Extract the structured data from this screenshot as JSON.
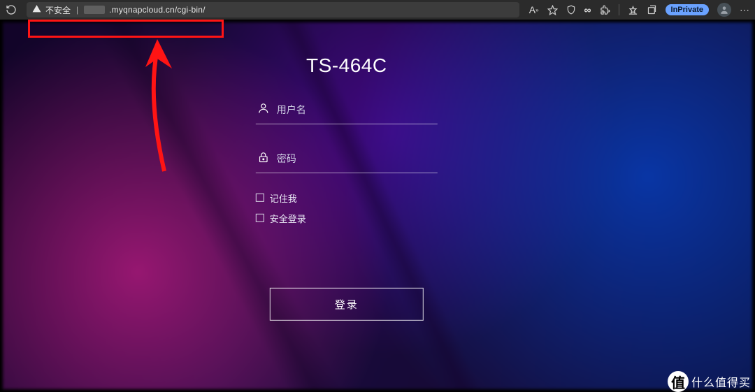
{
  "browser": {
    "security_label": "不安全",
    "url_visible": ".myqnapcloud.cn/cgi-bin/",
    "inprivate_label": "InPrivate"
  },
  "login": {
    "title": "TS-464C",
    "username_placeholder": "用户名",
    "password_placeholder": "密码",
    "remember_label": "记住我",
    "secure_label": "安全登录",
    "submit_label": "登录"
  },
  "watermark": {
    "badge_char": "值",
    "text": "什么值得买"
  }
}
